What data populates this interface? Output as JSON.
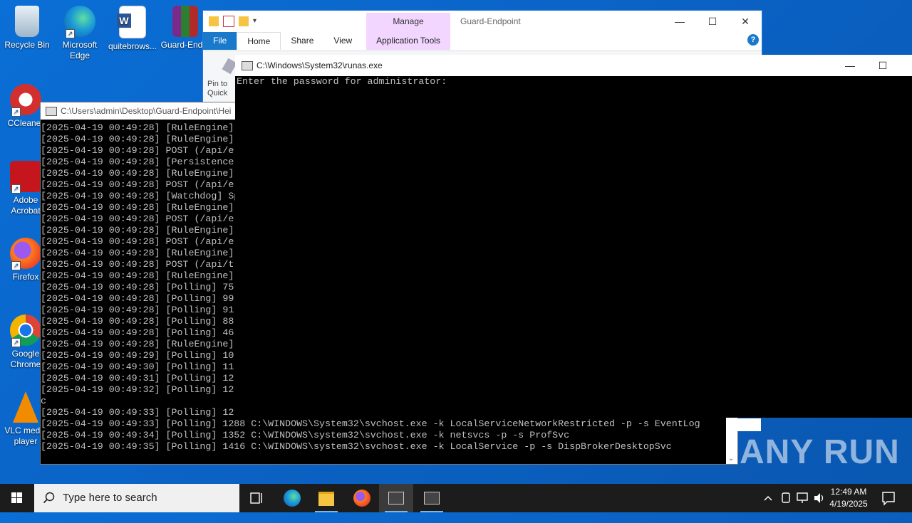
{
  "desktop": {
    "icons": [
      {
        "label": "Recycle Bin"
      },
      {
        "label": "Microsoft Edge"
      },
      {
        "label": "quitebrows..."
      },
      {
        "label": "Guard-End..."
      },
      {
        "label": "CCleaner"
      },
      {
        "label": "Adobe Acrobat"
      },
      {
        "label": "Firefox"
      },
      {
        "label": "Google Chrome"
      },
      {
        "label": "VLC media player"
      }
    ]
  },
  "explorer": {
    "title": "Guard-Endpoint",
    "manage_label": "Manage",
    "tabs": {
      "file": "File",
      "home": "Home",
      "share": "Share",
      "view": "View",
      "app_tools": "Application Tools"
    },
    "pin_label": "Pin to Quick access",
    "help": "?"
  },
  "console_log": {
    "title": "C:\\Users\\admin\\Desktop\\Guard-Endpoint\\Hei",
    "lines": [
      "[2025-04-19 00:49:28] [RuleEngine]",
      "[2025-04-19 00:49:28] [RuleEngine]",
      "[2025-04-19 00:49:28] POST (/api/e",
      "[2025-04-19 00:49:28] [Persistence",
      "[2025-04-19 00:49:28] [RuleEngine]",
      "[2025-04-19 00:49:28] POST (/api/e",
      "[2025-04-19 00:49:28] [Watchdog] Sp",
      "[2025-04-19 00:49:28] [RuleEngine]",
      "[2025-04-19 00:49:28] POST (/api/e",
      "[2025-04-19 00:49:28] [RuleEngine]",
      "[2025-04-19 00:49:28] POST (/api/e",
      "[2025-04-19 00:49:28] [RuleEngine]",
      "[2025-04-19 00:49:28] POST (/api/t",
      "[2025-04-19 00:49:28] [RuleEngine]",
      "[2025-04-19 00:49:28] [Polling] 75",
      "[2025-04-19 00:49:28] [Polling] 99",
      "[2025-04-19 00:49:28] [Polling] 91",
      "[2025-04-19 00:49:28] [Polling] 88",
      "[2025-04-19 00:49:28] [Polling] 46",
      "[2025-04-19 00:49:28] [RuleEngine]",
      "[2025-04-19 00:49:29] [Polling] 10",
      "[2025-04-19 00:49:30] [Polling] 11",
      "[2025-04-19 00:49:31] [Polling] 12",
      "[2025-04-19 00:49:32] [Polling] 12",
      "c",
      "[2025-04-19 00:49:33] [Polling] 12",
      "[2025-04-19 00:49:33] [Polling] 1288 C:\\WINDOWS\\System32\\svchost.exe -k LocalServiceNetworkRestricted -p -s EventLog",
      "[2025-04-19 00:49:34] [Polling] 1352 C:\\WINDOWS\\system32\\svchost.exe -k netsvcs -p -s ProfSvc",
      "[2025-04-19 00:49:35] [Polling] 1416 C:\\WINDOWS\\system32\\svchost.exe -k LocalService -p -s DispBrokerDesktopSvc"
    ]
  },
  "runas": {
    "title": "C:\\Windows\\System32\\runas.exe",
    "prompt": "Enter the password for administrator:"
  },
  "watermark": "ANY RUN",
  "taskbar": {
    "search_placeholder": "Type here to search",
    "time": "12:49 AM",
    "date": "4/19/2025"
  }
}
